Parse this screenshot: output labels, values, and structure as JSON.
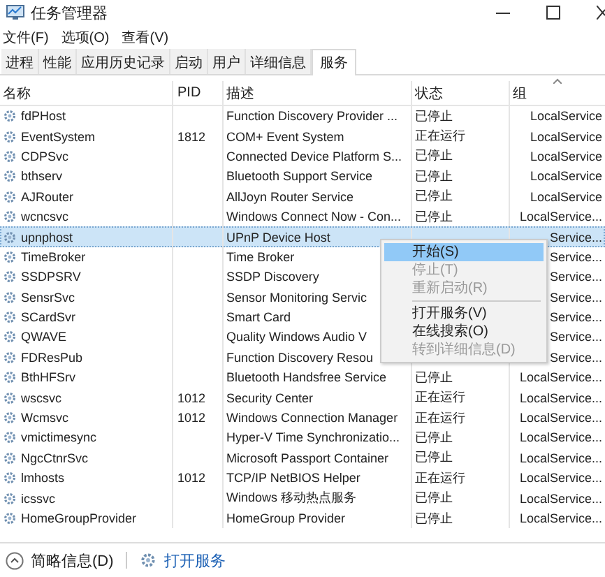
{
  "window": {
    "title": "任务管理器"
  },
  "menu": [
    "文件(F)",
    "选项(O)",
    "查看(V)"
  ],
  "tabs": [
    {
      "label": "进程",
      "selected": false
    },
    {
      "label": "性能",
      "selected": false
    },
    {
      "label": "应用历史记录",
      "selected": false
    },
    {
      "label": "启动",
      "selected": false
    },
    {
      "label": "用户",
      "selected": false
    },
    {
      "label": "详细信息",
      "selected": false
    },
    {
      "label": "服务",
      "selected": true
    }
  ],
  "table": {
    "columns": [
      "名称",
      "PID",
      "描述",
      "状态",
      "组"
    ],
    "rows": [
      {
        "name": "fdPHost",
        "description": "Function Discovery Provider ...",
        "status": "已停止",
        "group": "LocalService",
        "selected": false
      },
      {
        "name": "EventSystem",
        "pid": "1812",
        "description": "COM+ Event System",
        "status": "正在运行",
        "group": "LocalService",
        "selected": false
      },
      {
        "name": "CDPSvc",
        "description": "Connected Device Platform S...",
        "status": "已停止",
        "group": "LocalService",
        "selected": false
      },
      {
        "name": "bthserv",
        "description": "Bluetooth Support Service",
        "status": "已停止",
        "group": "LocalService",
        "selected": false
      },
      {
        "name": "AJRouter",
        "description": "AllJoyn Router Service",
        "status": "已停止",
        "group": "LocalService",
        "selected": false
      },
      {
        "name": "wcncsvc",
        "description": "Windows Connect Now - Con...",
        "status": "已停止",
        "group": "LocalService...",
        "selected": false
      },
      {
        "name": "upnphost",
        "description": "UPnP Device Host",
        "group": "Service...",
        "selected": true
      },
      {
        "name": "TimeBroker",
        "description": "Time Broker",
        "group": "Service...",
        "selected": false
      },
      {
        "name": "SSDPSRV",
        "description": "SSDP Discovery",
        "group": "Service...",
        "selected": false
      },
      {
        "name": "SensrSvc",
        "description": "Sensor Monitoring Servic",
        "group": "Service...",
        "selected": false
      },
      {
        "name": "SCardSvr",
        "description": "Smart Card",
        "group": "Service...",
        "selected": false
      },
      {
        "name": "QWAVE",
        "description": "Quality Windows Audio V",
        "group": "Service...",
        "selected": false
      },
      {
        "name": "FDResPub",
        "description": "Function Discovery Resou",
        "group": "Service...",
        "selected": false
      },
      {
        "name": "BthHFSrv",
        "description": "Bluetooth Handsfree Service",
        "status": "已停止",
        "group": "LocalService...",
        "selected": false
      },
      {
        "name": "wscsvc",
        "pid": "1012",
        "description": "Security Center",
        "status": "正在运行",
        "group": "LocalService...",
        "selected": false
      },
      {
        "name": "Wcmsvc",
        "pid": "1012",
        "description": "Windows Connection Manager",
        "status": "正在运行",
        "group": "LocalService...",
        "selected": false
      },
      {
        "name": "vmictimesync",
        "description": "Hyper-V Time Synchronizatio...",
        "status": "已停止",
        "group": "LocalService...",
        "selected": false
      },
      {
        "name": "NgcCtnrSvc",
        "description": "Microsoft Passport Container",
        "status": "已停止",
        "group": "LocalService...",
        "selected": false
      },
      {
        "name": "lmhosts",
        "pid": "1012",
        "description": "TCP/IP NetBIOS Helper",
        "status": "正在运行",
        "group": "LocalService...",
        "selected": false
      },
      {
        "name": "icssvc",
        "description": "Windows 移动热点服务",
        "status": "已停止",
        "group": "LocalService...",
        "selected": false
      },
      {
        "name": "HomeGroupProvider",
        "description": "HomeGroup Provider",
        "status": "已停止",
        "group": "LocalService...",
        "selected": false
      }
    ]
  },
  "context_menu": [
    {
      "label": "开始(S)",
      "kind": "item",
      "selected": true,
      "disabled": false
    },
    {
      "label": "停止(T)",
      "kind": "item",
      "selected": false,
      "disabled": true
    },
    {
      "label": "重新启动(R)",
      "kind": "item",
      "selected": false,
      "disabled": true
    },
    {
      "kind": "separator"
    },
    {
      "label": "打开服务(V)",
      "kind": "item",
      "selected": false,
      "disabled": false
    },
    {
      "label": "在线搜索(O)",
      "kind": "item",
      "selected": false,
      "disabled": false
    },
    {
      "label": "转到详细信息(D)",
      "kind": "item",
      "selected": false,
      "disabled": true
    }
  ],
  "status_bar": {
    "details": "简略信息(D)",
    "link": "打开服务"
  }
}
